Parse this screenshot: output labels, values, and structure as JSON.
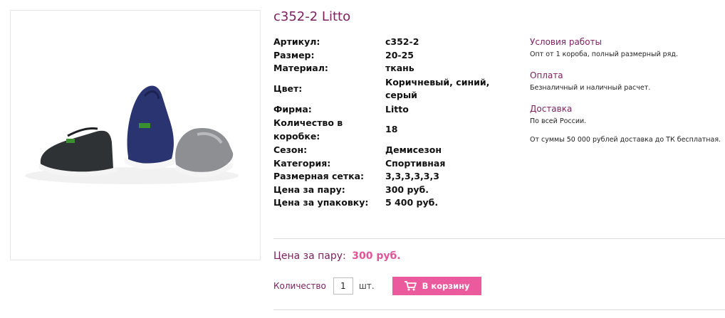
{
  "product": {
    "title": "c352-2 Litto",
    "image_alt": "shoes-photo"
  },
  "specs": [
    {
      "label": "Артикул:",
      "value": "c352-2"
    },
    {
      "label": "Размер:",
      "value": "20-25"
    },
    {
      "label": "Материал:",
      "value": "ткань"
    },
    {
      "label": "Цвет:",
      "value": "Коричневый, синий, серый"
    },
    {
      "label": "Фирма:",
      "value": "Litto"
    },
    {
      "label": "Количество в коробке:",
      "value": "18"
    },
    {
      "label": "Сезон:",
      "value": "Демисезон"
    },
    {
      "label": "Категория:",
      "value": "Спортивная"
    },
    {
      "label": "Размерная сетка:",
      "value": "3,3,3,3,3,3"
    },
    {
      "label": "Цена за пару:",
      "value": "300 руб."
    },
    {
      "label": "Цена за упаковку:",
      "value": "5 400 руб."
    }
  ],
  "info": {
    "terms_heading": "Условия работы",
    "terms_text": "Опт от 1 короба, полный размерный ряд.",
    "payment_heading": "Оплата",
    "payment_text": "Безналичный и наличный расчет.",
    "delivery_heading": "Доставка",
    "delivery_text": "По всей России.",
    "delivery_extra": "От суммы 50 000 рублей доставка до ТК бесплатная."
  },
  "purchase": {
    "price_label": "Цена за пару:",
    "price_value": "300 руб.",
    "quantity_label": "Количество",
    "quantity_value": "1",
    "quantity_unit": "шт.",
    "cart_button_label": "В корзину",
    "cart_icon": "cart-icon"
  },
  "colors": {
    "accent": "#7b1f5e",
    "price": "#e0559a",
    "button": "#ea5a9c"
  }
}
